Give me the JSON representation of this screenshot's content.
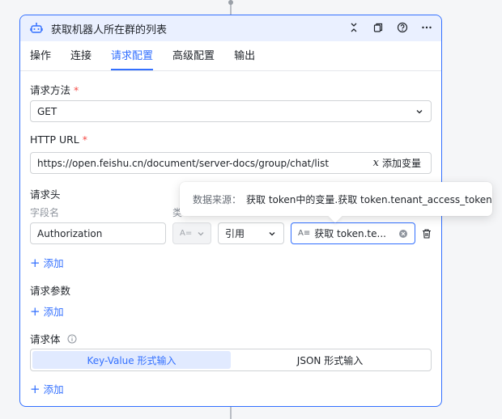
{
  "node": {
    "title": "获取机器人所在群的列表",
    "icon": "bot-icon",
    "actions": [
      "collapse-icon",
      "copy-icon",
      "help-icon",
      "more-icon"
    ]
  },
  "tabs": [
    {
      "label": "操作",
      "active": false
    },
    {
      "label": "连接",
      "active": false
    },
    {
      "label": "请求配置",
      "active": true
    },
    {
      "label": "高级配置",
      "active": false
    },
    {
      "label": "输出",
      "active": false
    }
  ],
  "method": {
    "label": "请求方法",
    "required": "*",
    "value": "GET"
  },
  "url": {
    "label": "HTTP URL",
    "required": "*",
    "value": "https://open.feishu.cn/document/server-docs/group/chat/list",
    "add_var": "添加变量"
  },
  "headers": {
    "label": "请求头",
    "col_field": "字段名",
    "col_type": "类",
    "row": {
      "field": "Authorization",
      "type_icon": "A=",
      "ref": "引用",
      "value": "获取 token.te..."
    },
    "add": "添加"
  },
  "params": {
    "label": "请求参数",
    "add": "添加"
  },
  "body": {
    "label": "请求体",
    "options": [
      "Key-Value 形式输入",
      "JSON 形式输入"
    ],
    "selected": "Key-Value 形式输入",
    "add": "添加"
  },
  "tooltip": {
    "key": "数据来源：",
    "value": "获取 token中的变量.获取 token.tenant_access_token"
  },
  "colors": {
    "accent": "#3370ff",
    "header_bg": "#eaf0ff",
    "required": "#f54a45"
  }
}
